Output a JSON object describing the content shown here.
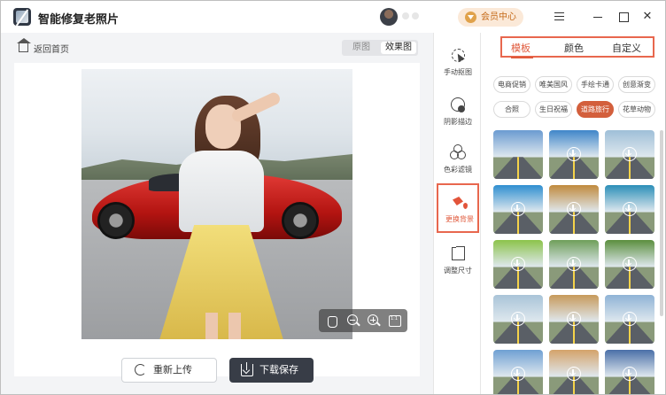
{
  "app": {
    "title": "智能修复老照片"
  },
  "header": {
    "vip_label": "会员中心"
  },
  "workspace": {
    "back_label": "返回首页",
    "view_toggle": {
      "original": "原图",
      "effect": "效果图",
      "selected": "效果图"
    },
    "reupload_label": "重新上传",
    "download_label": "下载保存"
  },
  "tools": [
    {
      "label": "手动抠图",
      "icon": "cutout-icon",
      "active": false
    },
    {
      "label": "阴影描边",
      "icon": "shadow-icon",
      "active": false
    },
    {
      "label": "色彩滤镜",
      "icon": "color-filter-icon",
      "active": false
    },
    {
      "label": "更换背景",
      "icon": "bucket-icon",
      "active": true
    },
    {
      "label": "调整尺寸",
      "icon": "resize-icon",
      "active": false
    }
  ],
  "panel": {
    "tabs": [
      {
        "label": "模板",
        "active": true
      },
      {
        "label": "颜色",
        "active": false
      },
      {
        "label": "自定义",
        "active": false
      }
    ],
    "categories": [
      {
        "label": "电商促销",
        "active": false
      },
      {
        "label": "唯美国风",
        "active": false
      },
      {
        "label": "手绘卡通",
        "active": false
      },
      {
        "label": "创意渐变",
        "active": false
      },
      {
        "label": "合照",
        "active": false
      },
      {
        "label": "生日祝福",
        "active": false
      },
      {
        "label": "道路旅行",
        "active": true
      },
      {
        "label": "花草动物",
        "active": false
      }
    ],
    "thumb_colors": [
      "#6a9bd1",
      "#3f86c9",
      "#9fbfd8",
      "#2f8fd0",
      "#c08a3d",
      "#2c8fb8",
      "#8cc34a",
      "#6f9f5a",
      "#5b8f3e",
      "#a9c4d8",
      "#c79a5b",
      "#8fb3d6",
      "#6fa0d3",
      "#d4a36a",
      "#4a6fa8"
    ]
  }
}
